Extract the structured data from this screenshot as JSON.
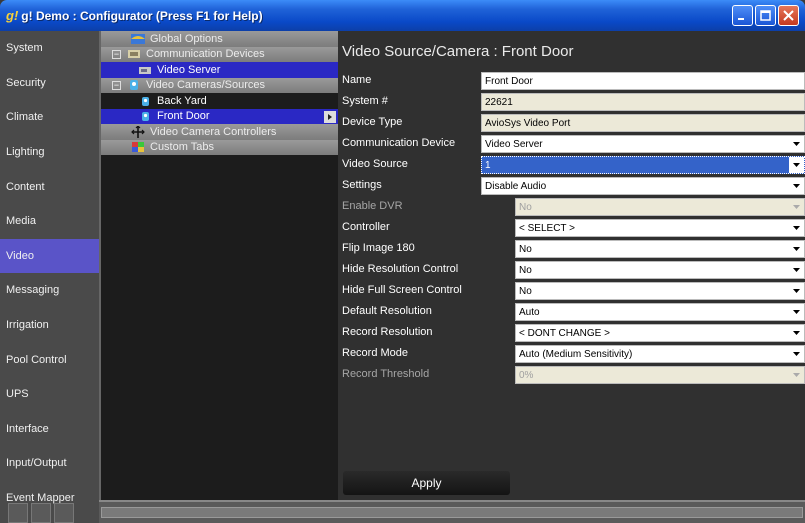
{
  "window": {
    "title": "g! Demo : Configurator   (Press F1 for Help)",
    "icon_glyph": "g!",
    "colors": {
      "titlebar": "#0a49c8",
      "accent": "#5a54c8",
      "selected": "#2a28c4"
    }
  },
  "leftnav": {
    "items": [
      {
        "label": "System"
      },
      {
        "label": "Security"
      },
      {
        "label": "Climate"
      },
      {
        "label": "Lighting"
      },
      {
        "label": "Content"
      },
      {
        "label": "Media"
      },
      {
        "label": "Video"
      },
      {
        "label": "Messaging"
      },
      {
        "label": "Irrigation"
      },
      {
        "label": "Pool Control"
      },
      {
        "label": "UPS"
      },
      {
        "label": "Interface"
      },
      {
        "label": "Input/Output"
      },
      {
        "label": "Event Mapper"
      }
    ],
    "active_index": 6
  },
  "tree": {
    "items": [
      {
        "label": "Global Options",
        "icon": "globe-icon",
        "kind": "group"
      },
      {
        "label": "Communication Devices",
        "icon": "network-icon",
        "kind": "group"
      },
      {
        "label": "Video Server",
        "icon": "server-icon",
        "kind": "child-selected"
      },
      {
        "label": "Video Cameras/Sources",
        "icon": "camera-icon",
        "kind": "group"
      },
      {
        "label": "Back Yard",
        "icon": "camera-icon",
        "kind": "child"
      },
      {
        "label": "Front Door",
        "icon": "camera-icon",
        "kind": "child-selected"
      },
      {
        "label": "Video Camera Controllers",
        "icon": "move-arrows-icon",
        "kind": "group"
      },
      {
        "label": "Custom Tabs",
        "icon": "tabs-icon",
        "kind": "group"
      }
    ]
  },
  "main": {
    "title": "Video Source/Camera : Front Door",
    "fields": [
      {
        "label": "Name",
        "value": "Front Door",
        "type": "text"
      },
      {
        "label": "System #",
        "value": "22621",
        "type": "readonly"
      },
      {
        "label": "Device Type",
        "value": "AvioSys Video Port",
        "type": "readonly"
      },
      {
        "label": "Communication Device",
        "value": "Video Server",
        "type": "select"
      },
      {
        "label": "Video Source",
        "value": "1",
        "type": "select-highlight"
      },
      {
        "label": "Settings",
        "value": "Disable Audio",
        "type": "select"
      },
      {
        "label": "Enable DVR",
        "value": "No",
        "type": "select-disabled"
      },
      {
        "label": "Controller",
        "value": "< SELECT >",
        "type": "select-short"
      },
      {
        "label": "Flip Image 180",
        "value": "No",
        "type": "select-short"
      },
      {
        "label": "Hide Resolution Control",
        "value": "No",
        "type": "select-short"
      },
      {
        "label": "Hide Full Screen Control",
        "value": "No",
        "type": "select-short"
      },
      {
        "label": "Default Resolution",
        "value": "Auto",
        "type": "select-short"
      },
      {
        "label": "Record Resolution",
        "value": "< DONT CHANGE >",
        "type": "select-short"
      },
      {
        "label": "Record Mode",
        "value": "Auto (Medium Sensitivity)",
        "type": "select-short"
      },
      {
        "label": "Record Threshold",
        "value": "0%",
        "type": "select-disabled"
      }
    ],
    "apply_label": "Apply"
  }
}
